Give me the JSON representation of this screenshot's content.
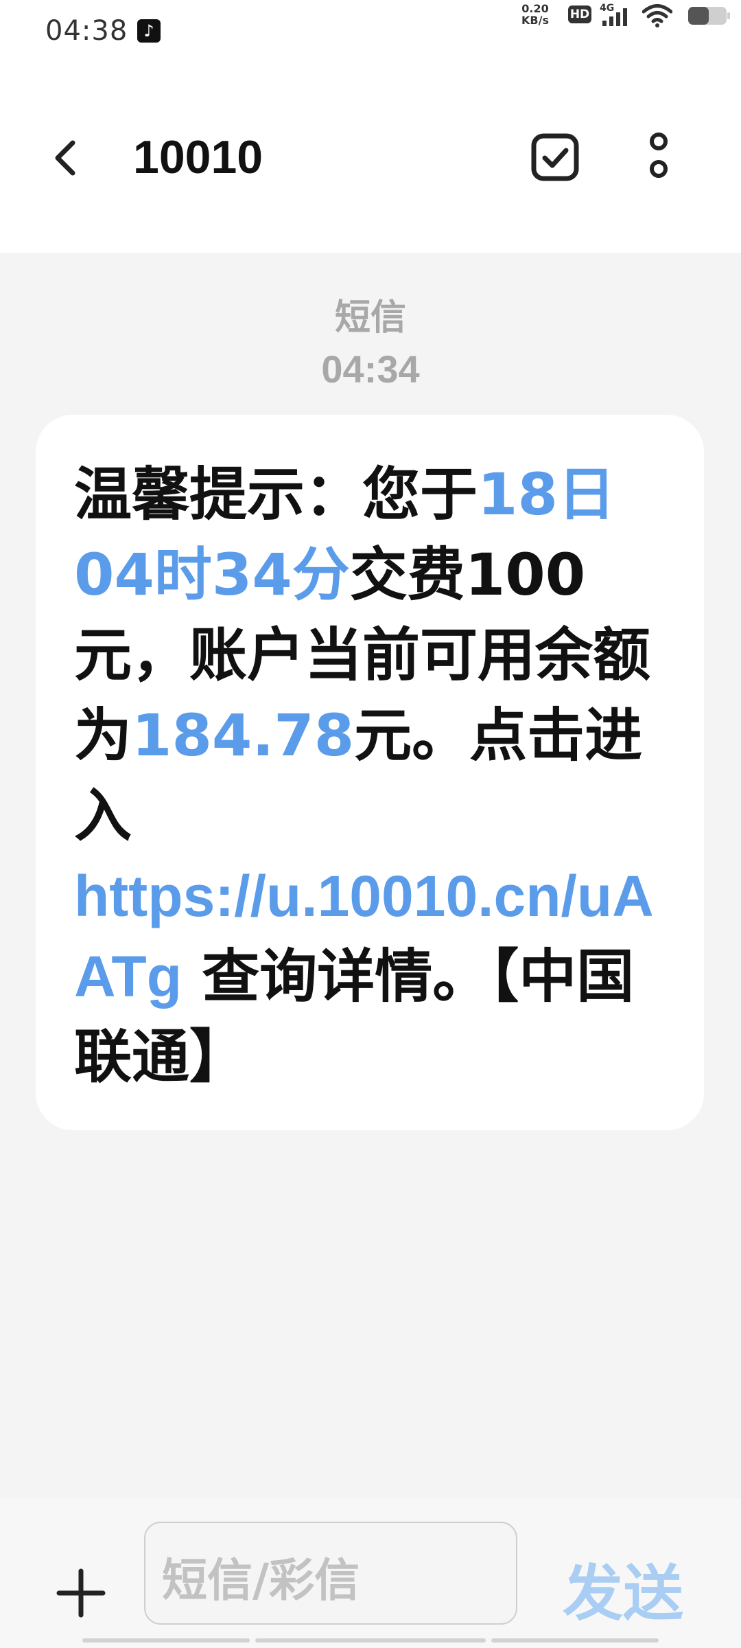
{
  "status_bar": {
    "time": "04:38",
    "app_icon": "tiktok-icon",
    "net_speed_value": "0.20",
    "net_speed_unit": "KB/s",
    "hd": "HD",
    "network": "4G",
    "icons": [
      "signal-icon",
      "wifi-icon",
      "battery-icon"
    ]
  },
  "header": {
    "title": "10010",
    "icons": [
      "back-icon",
      "select-icon",
      "more-vertical-icon"
    ]
  },
  "message": {
    "type": "短信",
    "time": "04:34",
    "segments": {
      "s1": "温馨提示：您于",
      "date": "18日",
      "time_val": "04时34分",
      "s2": "交费100元，账户当前可用余额为",
      "balance": "184.78",
      "s3": "元。点击进入",
      "url": "https://u.10010.cn/uAATg",
      "s4": " 查询详情。【中国联通】"
    }
  },
  "composer": {
    "placeholder": "短信/彩信",
    "send_label": "发送",
    "icons": [
      "plus-icon"
    ]
  },
  "colors": {
    "accent": "#5b9cea",
    "send_disabled": "#a9cdf3",
    "background": "#f4f4f4",
    "bubble": "#ffffff"
  }
}
